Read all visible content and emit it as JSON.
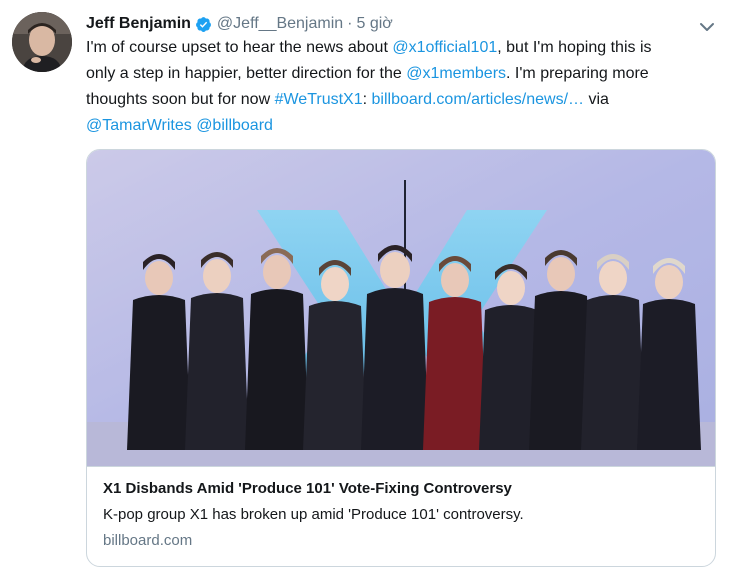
{
  "tweet": {
    "author_name": "Jeff Benjamin",
    "author_handle": "@Jeff__Benjamin",
    "separator": "·",
    "time": "5 giờ",
    "line1": {
      "t1": "I'm of course upset to hear the news about ",
      "m1": "@x1official101",
      "t2": ", but I'm hoping this is"
    },
    "line2": {
      "t1": "only a step in happier, better direction for the ",
      "m1": "@x1members",
      "t2": ". I'm preparing more"
    },
    "line3": {
      "t1": "thoughts soon but for now ",
      "hashtag": "#WeTrustX1",
      "t2": ": ",
      "url": "billboard.com/articles/news/…",
      "t3": " via"
    },
    "line4": {
      "m1": "@TamarWrites",
      "sp": " ",
      "m2": "@billboard"
    }
  },
  "card": {
    "title": "X1 Disbands Amid 'Produce 101' Vote-Fixing Controversy",
    "description": "K-pop group X1 has broken up amid 'Produce 101' controversy.",
    "domain": "billboard.com"
  },
  "icons": {
    "verified": "verified-badge-icon",
    "caret": "chevron-down-icon"
  },
  "colors": {
    "link": "#1b95e0",
    "secondary": "#657786",
    "border": "#ccd6dd"
  }
}
